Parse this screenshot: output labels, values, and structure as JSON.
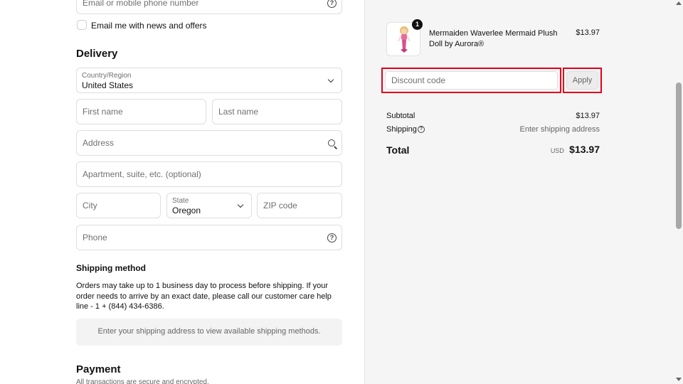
{
  "contact": {
    "email_placeholder": "Email or mobile phone number",
    "news_label": "Email me with news and offers"
  },
  "delivery": {
    "heading": "Delivery",
    "country_label": "Country/Region",
    "country_value": "United States",
    "first_name_placeholder": "First name",
    "last_name_placeholder": "Last name",
    "address_placeholder": "Address",
    "apartment_placeholder": "Apartment, suite, etc. (optional)",
    "city_placeholder": "City",
    "state_label": "State",
    "state_value": "Oregon",
    "zip_placeholder": "ZIP code",
    "phone_placeholder": "Phone"
  },
  "shipping_method": {
    "heading": "Shipping method",
    "notice": "Orders may take up to 1 business day to process before shipping. If your order needs to arrive by an exact date, please call our customer care help line - 1 + (844) 434-6386.",
    "empty_message": "Enter your shipping address to view available shipping methods."
  },
  "payment": {
    "heading": "Payment",
    "subtext": "All transactions are secure and encrypted."
  },
  "summary": {
    "item": {
      "name": "Mermaiden Waverlee Mermaid Plush Doll by Aurora®",
      "price": "$13.97",
      "quantity": "1"
    },
    "discount_placeholder": "Discount code",
    "apply_label": "Apply",
    "subtotal_label": "Subtotal",
    "subtotal_value": "$13.97",
    "shipping_label": "Shipping",
    "shipping_value": "Enter shipping address",
    "total_label": "Total",
    "total_currency": "USD",
    "total_value": "$13.97"
  },
  "colors": {
    "highlight": "#e0001b",
    "panel_bg": "#f5f5f5"
  }
}
